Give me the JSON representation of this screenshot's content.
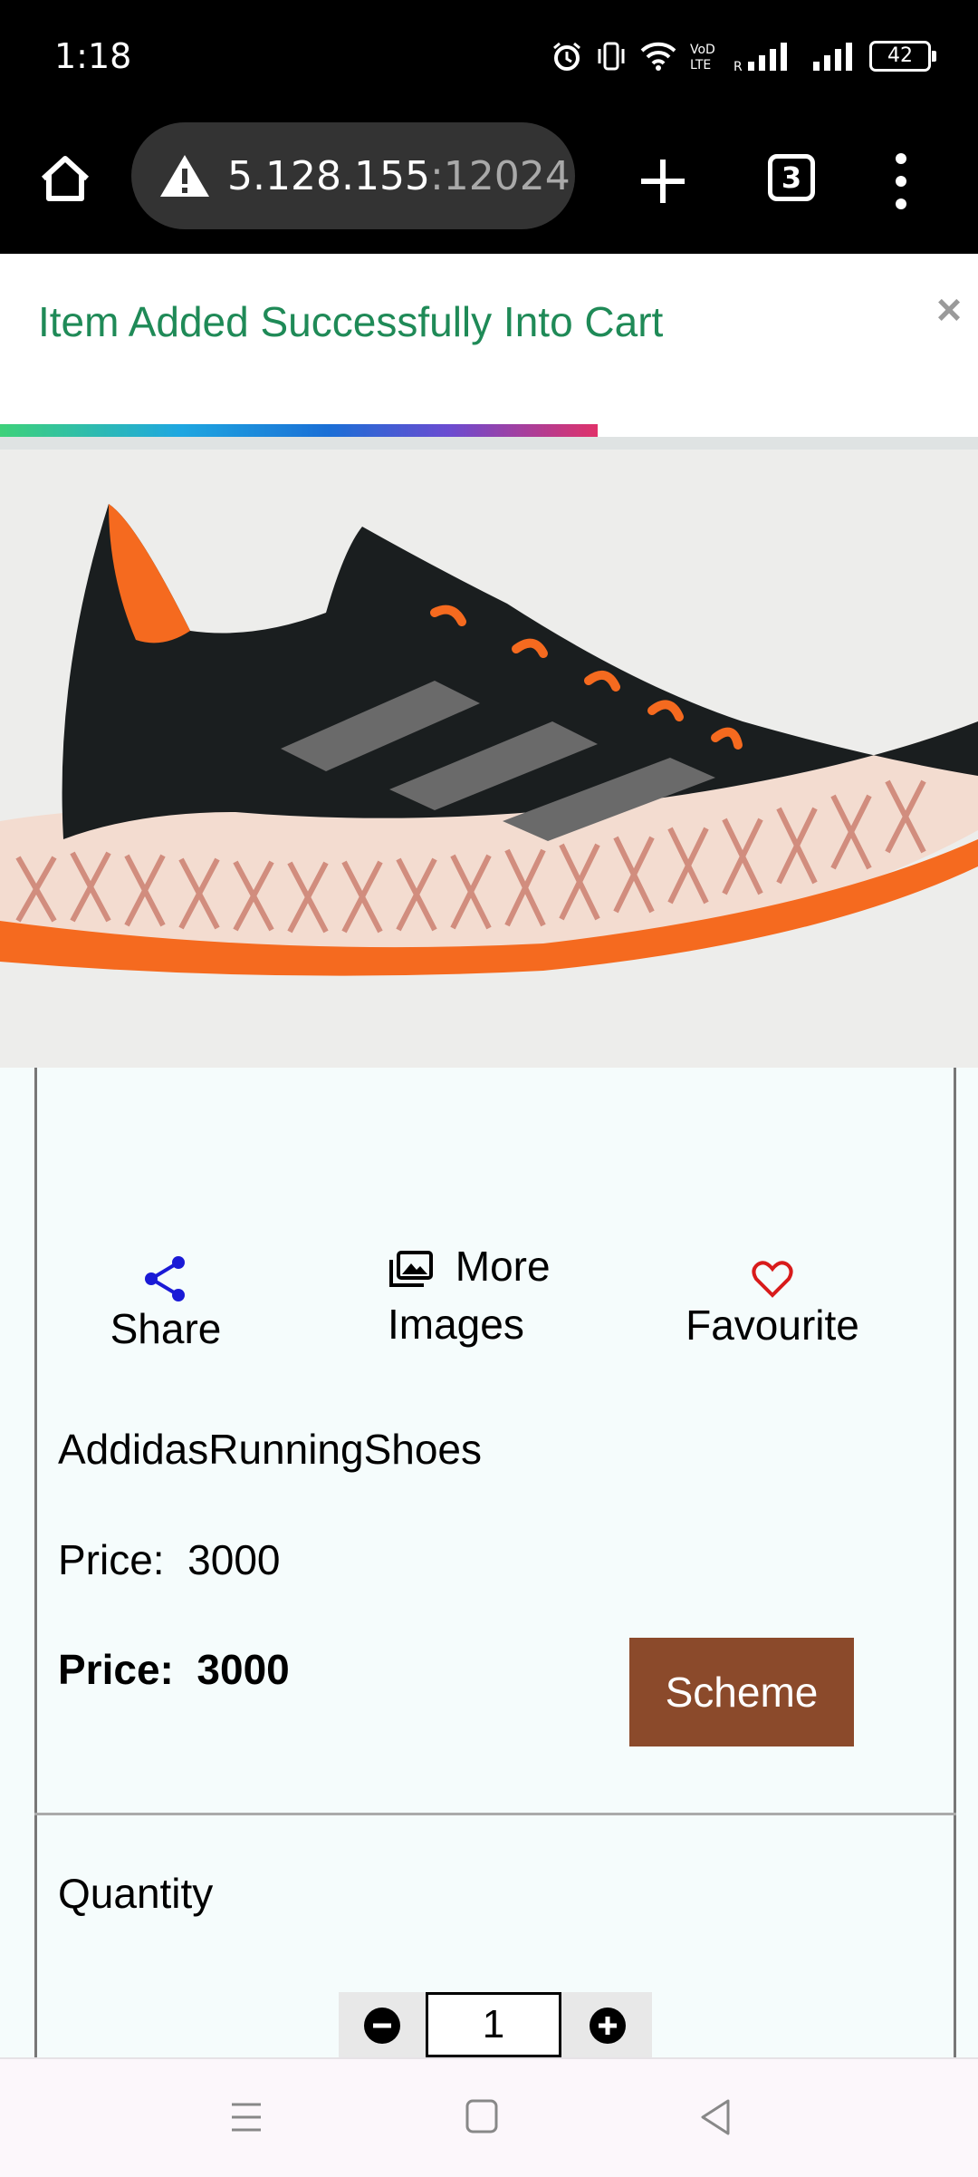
{
  "status_bar": {
    "time": "1:18",
    "battery": "42",
    "icons": [
      "alarm-icon",
      "vibrate-icon",
      "wifi-icon",
      "volte-icon",
      "signal-icon",
      "signal-icon",
      "battery-icon"
    ]
  },
  "browser": {
    "url_host": "5.128.155",
    "url_port": ":12024",
    "tab_count": "3",
    "icons": [
      "home-icon",
      "warning-icon",
      "plus-icon",
      "menu-dots-icon"
    ]
  },
  "toast": {
    "message": "Item Added Successfully Into Cart",
    "close": "×",
    "progress": 0.61,
    "color": "#1f8a57"
  },
  "actions": {
    "share": "Share",
    "more_images_1": "More",
    "more_images_2": "Images",
    "favourite": "Favourite"
  },
  "product": {
    "name": "AddidasRunningShoes",
    "price_label": "Price:",
    "price": "3000",
    "price_bold_label": "Price:",
    "price_bold": "3000",
    "scheme_button": "Scheme",
    "quantity_label": "Quantity",
    "quantity_value": "1"
  },
  "colors": {
    "scheme_button": "#8b4a2b",
    "share_icon": "#1a1ad6",
    "favourite_icon": "#d81b1b"
  }
}
